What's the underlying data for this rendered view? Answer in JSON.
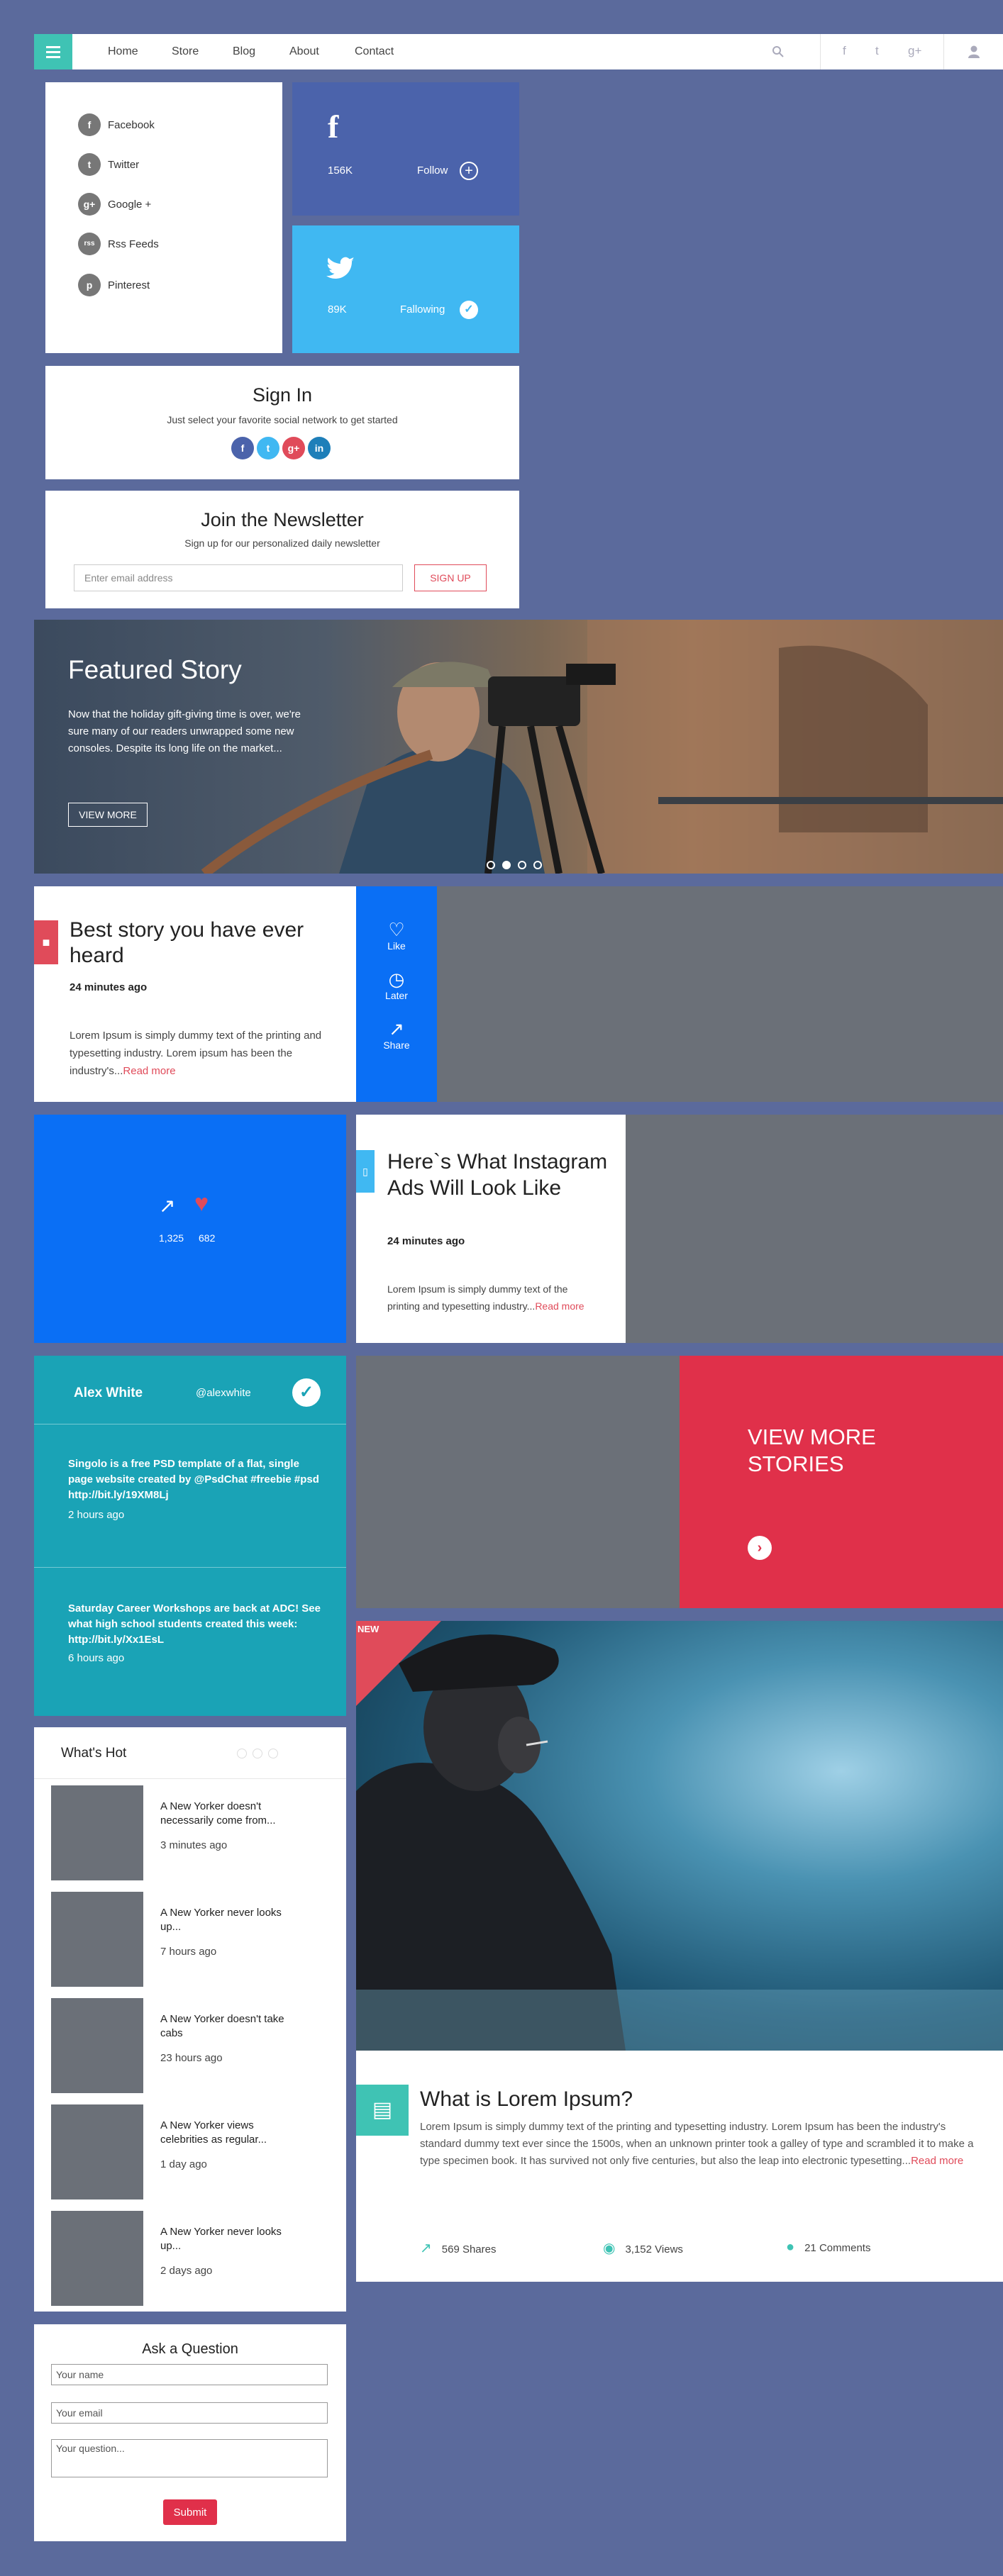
{
  "nav": {
    "links": [
      "Home",
      "Store",
      "Blog",
      "About",
      "Contact"
    ],
    "icons": [
      "search-icon",
      "facebook-icon",
      "twitter-icon",
      "google-plus-icon",
      "user-icon"
    ]
  },
  "social_list": {
    "items": [
      {
        "icon": "f",
        "label": "Facebook"
      },
      {
        "icon": "t",
        "label": "Twitter"
      },
      {
        "icon": "g+",
        "label": "Google +"
      },
      {
        "icon": "rss",
        "label": "Rss Feeds"
      },
      {
        "icon": "p",
        "label": "Pinterest"
      }
    ]
  },
  "facebook_card": {
    "count": "156K",
    "action": "Follow"
  },
  "twitter_card": {
    "count": "89K",
    "action": "Fallowing"
  },
  "signin": {
    "title": "Sign In",
    "subtitle": "Just select your favorite social network to get started",
    "networks": [
      {
        "icon": "f",
        "color": "#4b63ab"
      },
      {
        "icon": "t",
        "color": "#40b8f2"
      },
      {
        "icon": "g+",
        "color": "#e04b5a"
      },
      {
        "icon": "in",
        "color": "#1e7fb9"
      }
    ]
  },
  "newsletter": {
    "title": "Join the Newsletter",
    "subtitle": "Sign up for our personalized daily newsletter",
    "placeholder": "Enter email address",
    "button": "SIGN UP"
  },
  "featured": {
    "title": "Featured Story",
    "text": "Now that the holiday gift-giving time is over, we're sure many of our readers unwrapped some new consoles. Despite its long life on the market...",
    "button": "VIEW MORE"
  },
  "best_story": {
    "title": "Best story you have ever heard",
    "time": "24 minutes ago",
    "excerpt": "Lorem Ipsum is simply dummy text of the printing and typesetting industry. Lorem ipsum has been the industry's...",
    "read_more": "Read more"
  },
  "actions": {
    "like": "Like",
    "later": "Later",
    "share": "Share"
  },
  "stats": {
    "shares": "1,325",
    "likes": "682"
  },
  "insta_story": {
    "title": "Here`s What Instagram Ads Will Look Like",
    "time": "24 minutes ago",
    "excerpt": "Lorem Ipsum is simply dummy text of the printing and typesetting industry...",
    "read_more": "Read more"
  },
  "twitter_feed": {
    "name": "Alex White",
    "handle": "@alexwhite",
    "tweets": [
      {
        "text": "Singolo is a free PSD template of a flat, single page website created by @PsdChat #freebie #psd http://bit.ly/19XM8Lj",
        "time": "2 hours ago"
      },
      {
        "text": "Saturday Career Workshops are back at ADC! See what high school students created this week: http://bit.ly/Xx1EsL",
        "time": "6 hours ago"
      }
    ]
  },
  "view_more": {
    "label": "VIEW MORE STORIES"
  },
  "rain_image": {
    "badge": "NEW"
  },
  "lorem_card": {
    "title": "What is Lorem Ipsum?",
    "text": "Lorem Ipsum is simply dummy text of the printing and typesetting industry. Lorem Ipsum has been the industry's standard dummy text ever since the 1500s, when an unknown printer took a galley of type and scrambled it to make a type specimen book. It has survived not only five centuries, but also the leap into electronic typesetting...",
    "read_more": "Read more",
    "shares": "569 Shares",
    "views": "3,152 Views",
    "comments": "21 Comments"
  },
  "whats_hot": {
    "title": "What's Hot",
    "items": [
      {
        "title": "A New Yorker doesn't necessarily come from...",
        "time": "3 minutes ago"
      },
      {
        "title": "A New Yorker never looks up...",
        "time": "7 hours ago"
      },
      {
        "title": "A New Yorker doesn't take cabs",
        "time": "23 hours ago"
      },
      {
        "title": "A New Yorker views celebrities as regular...",
        "time": "1 day ago"
      },
      {
        "title": "A New Yorker never looks up...",
        "time": "2 days ago"
      }
    ]
  },
  "ask": {
    "title": "Ask a Question",
    "name_placeholder": "Your name",
    "email_placeholder": "Your email",
    "question_placeholder": "Your question...",
    "button": "Submit"
  },
  "colors": {
    "teal": "#3fc3b4",
    "blue": "#0a6ff5",
    "red": "#e0304a",
    "facebook": "#4b63ab",
    "twitter": "#40b8f2",
    "background": "#5b6a9c"
  }
}
